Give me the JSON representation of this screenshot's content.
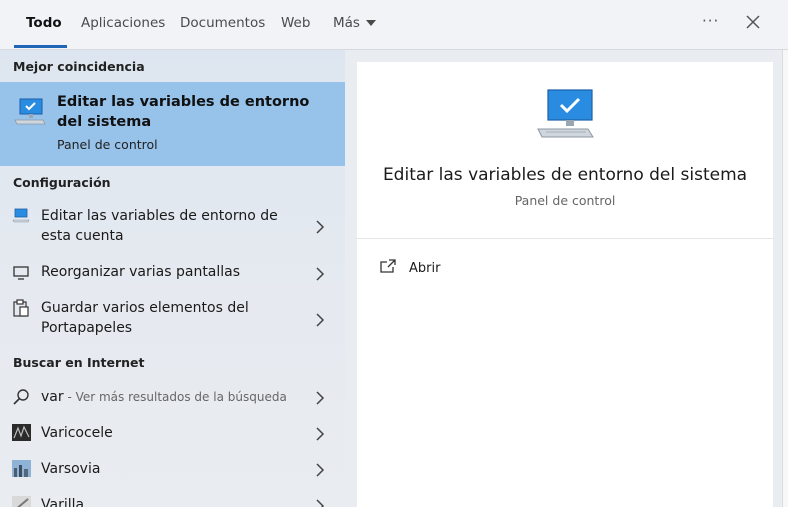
{
  "tabs": [
    {
      "label": "Todo"
    },
    {
      "label": "Aplicaciones"
    },
    {
      "label": "Documentos"
    },
    {
      "label": "Web"
    },
    {
      "label": "Más"
    }
  ],
  "more_icon": "···",
  "sections": {
    "best": "Mejor coincidencia",
    "config": "Configuración",
    "internet": "Buscar en Internet"
  },
  "best_match": {
    "title": "Editar las variables de entorno del sistema",
    "subtitle": "Panel de control",
    "icon": "computer-checkmark-icon"
  },
  "config_items": [
    {
      "label": "Editar las variables de entorno de esta cuenta",
      "icon": "computer-small-icon"
    },
    {
      "label": "Reorganizar varias pantallas",
      "icon": "monitor-icon"
    },
    {
      "label": "Guardar varios elementos del Portapapeles",
      "icon": "clipboard-icon"
    }
  ],
  "web_items": [
    {
      "label": "var",
      "sub": " - Ver más resultados de la búsqueda",
      "icon": "search-icon"
    },
    {
      "label": "Varicocele",
      "icon": "web-thumbnail"
    },
    {
      "label": "Varsovia",
      "icon": "web-thumbnail"
    },
    {
      "label": "Varilla",
      "icon": "web-thumbnail"
    }
  ],
  "preview": {
    "title": "Editar las variables de entorno del sistema",
    "subtitle": "Panel de control",
    "open_label": "Abrir"
  },
  "colors": {
    "accent": "#1f66b8",
    "selected": "#97c2ea"
  }
}
